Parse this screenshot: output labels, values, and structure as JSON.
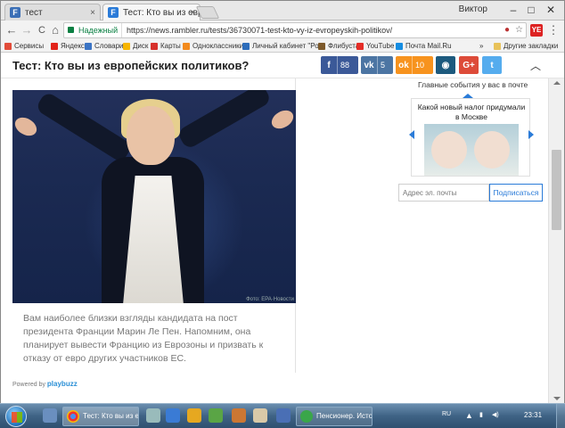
{
  "browser": {
    "tabs": [
      {
        "label": "тест",
        "favicon": "F",
        "favicon_color": "#3b6fb6"
      },
      {
        "label": "Тест: Кто вы из европейс",
        "favicon": "F",
        "favicon_color": "#2a7bd8"
      }
    ],
    "tab_close": "×",
    "user_name": "Виктор",
    "window_controls": {
      "minimize": "–",
      "maximize": "□",
      "close": "✕"
    },
    "nav": {
      "back": "←",
      "forward": "→",
      "reload": "C",
      "home": "⌂"
    },
    "address": {
      "secure_label": "Надежный",
      "url": "https://news.rambler.ru/tests/36730071-test-kto-vy-iz-evropeyskih-politikov/"
    },
    "ext_badge": "YE",
    "menu": "⋮",
    "bookmarks": [
      {
        "label": "Сервисы",
        "color": "#e24c3a"
      },
      {
        "label": "Яндекс",
        "color": "#e2231a"
      },
      {
        "label": "Словари",
        "color": "#3b74c4"
      },
      {
        "label": "Диск",
        "color": "#f7b500"
      },
      {
        "label": "Карты",
        "color": "#d7302b"
      },
      {
        "label": "Одноклассники",
        "color": "#f28a1d"
      },
      {
        "label": "Личный кабинет \"Ро",
        "color": "#2d6dbb"
      },
      {
        "label": "Флибуста",
        "color": "#7d5a2b"
      },
      {
        "label": "YouTube",
        "color": "#e52d27"
      },
      {
        "label": "Почта Mail.Ru",
        "color": "#168de2"
      }
    ],
    "bookmarks_more": "»",
    "other_bookmarks": "Другие закладки"
  },
  "page": {
    "title": "Тест: Кто вы из европейских политиков?",
    "share": [
      {
        "network": "facebook",
        "glyph": "f",
        "count": "88",
        "color": "#3b5998"
      },
      {
        "network": "vkontakte",
        "glyph": "vk",
        "count": "5",
        "color": "#4c75a3"
      },
      {
        "network": "odnoklassniki",
        "glyph": "ok",
        "count": "10",
        "color": "#f7931e"
      },
      {
        "network": "livejournal",
        "glyph": "◉",
        "color": "#1d5a7e"
      },
      {
        "network": "googleplus",
        "glyph": "G+",
        "color": "#dd4b39"
      },
      {
        "network": "twitter",
        "glyph": "t",
        "color": "#55acee"
      }
    ],
    "collapse": "︿",
    "quiz": {
      "result_text": "Вам наиболее близки взгляды кандидата на пост президента Франции Марин Ле Пен. Напомним, она планирует вывести Францию из Еврозоны и призвать к отказу от евро других участников ЕС.",
      "photo_credit": "Фото: EPA·Новости"
    },
    "powered_by": "Powered by",
    "powered_brand": "playbuzz",
    "sidebar": {
      "widget_title": "Главные события у вас в почте",
      "headline": "Какой новый налог придумали в Москве",
      "email_placeholder": "Адрес эл. почты",
      "subscribe": "Подписаться"
    }
  },
  "taskbar": {
    "tasks": [
      {
        "label": "Тест: Кто вы из европ...",
        "color": "#2a7bd8"
      },
      {
        "label": "Пенсионер. Истори...",
        "color": "#3aa64a"
      }
    ],
    "lang": "RU",
    "time": "23:31"
  }
}
